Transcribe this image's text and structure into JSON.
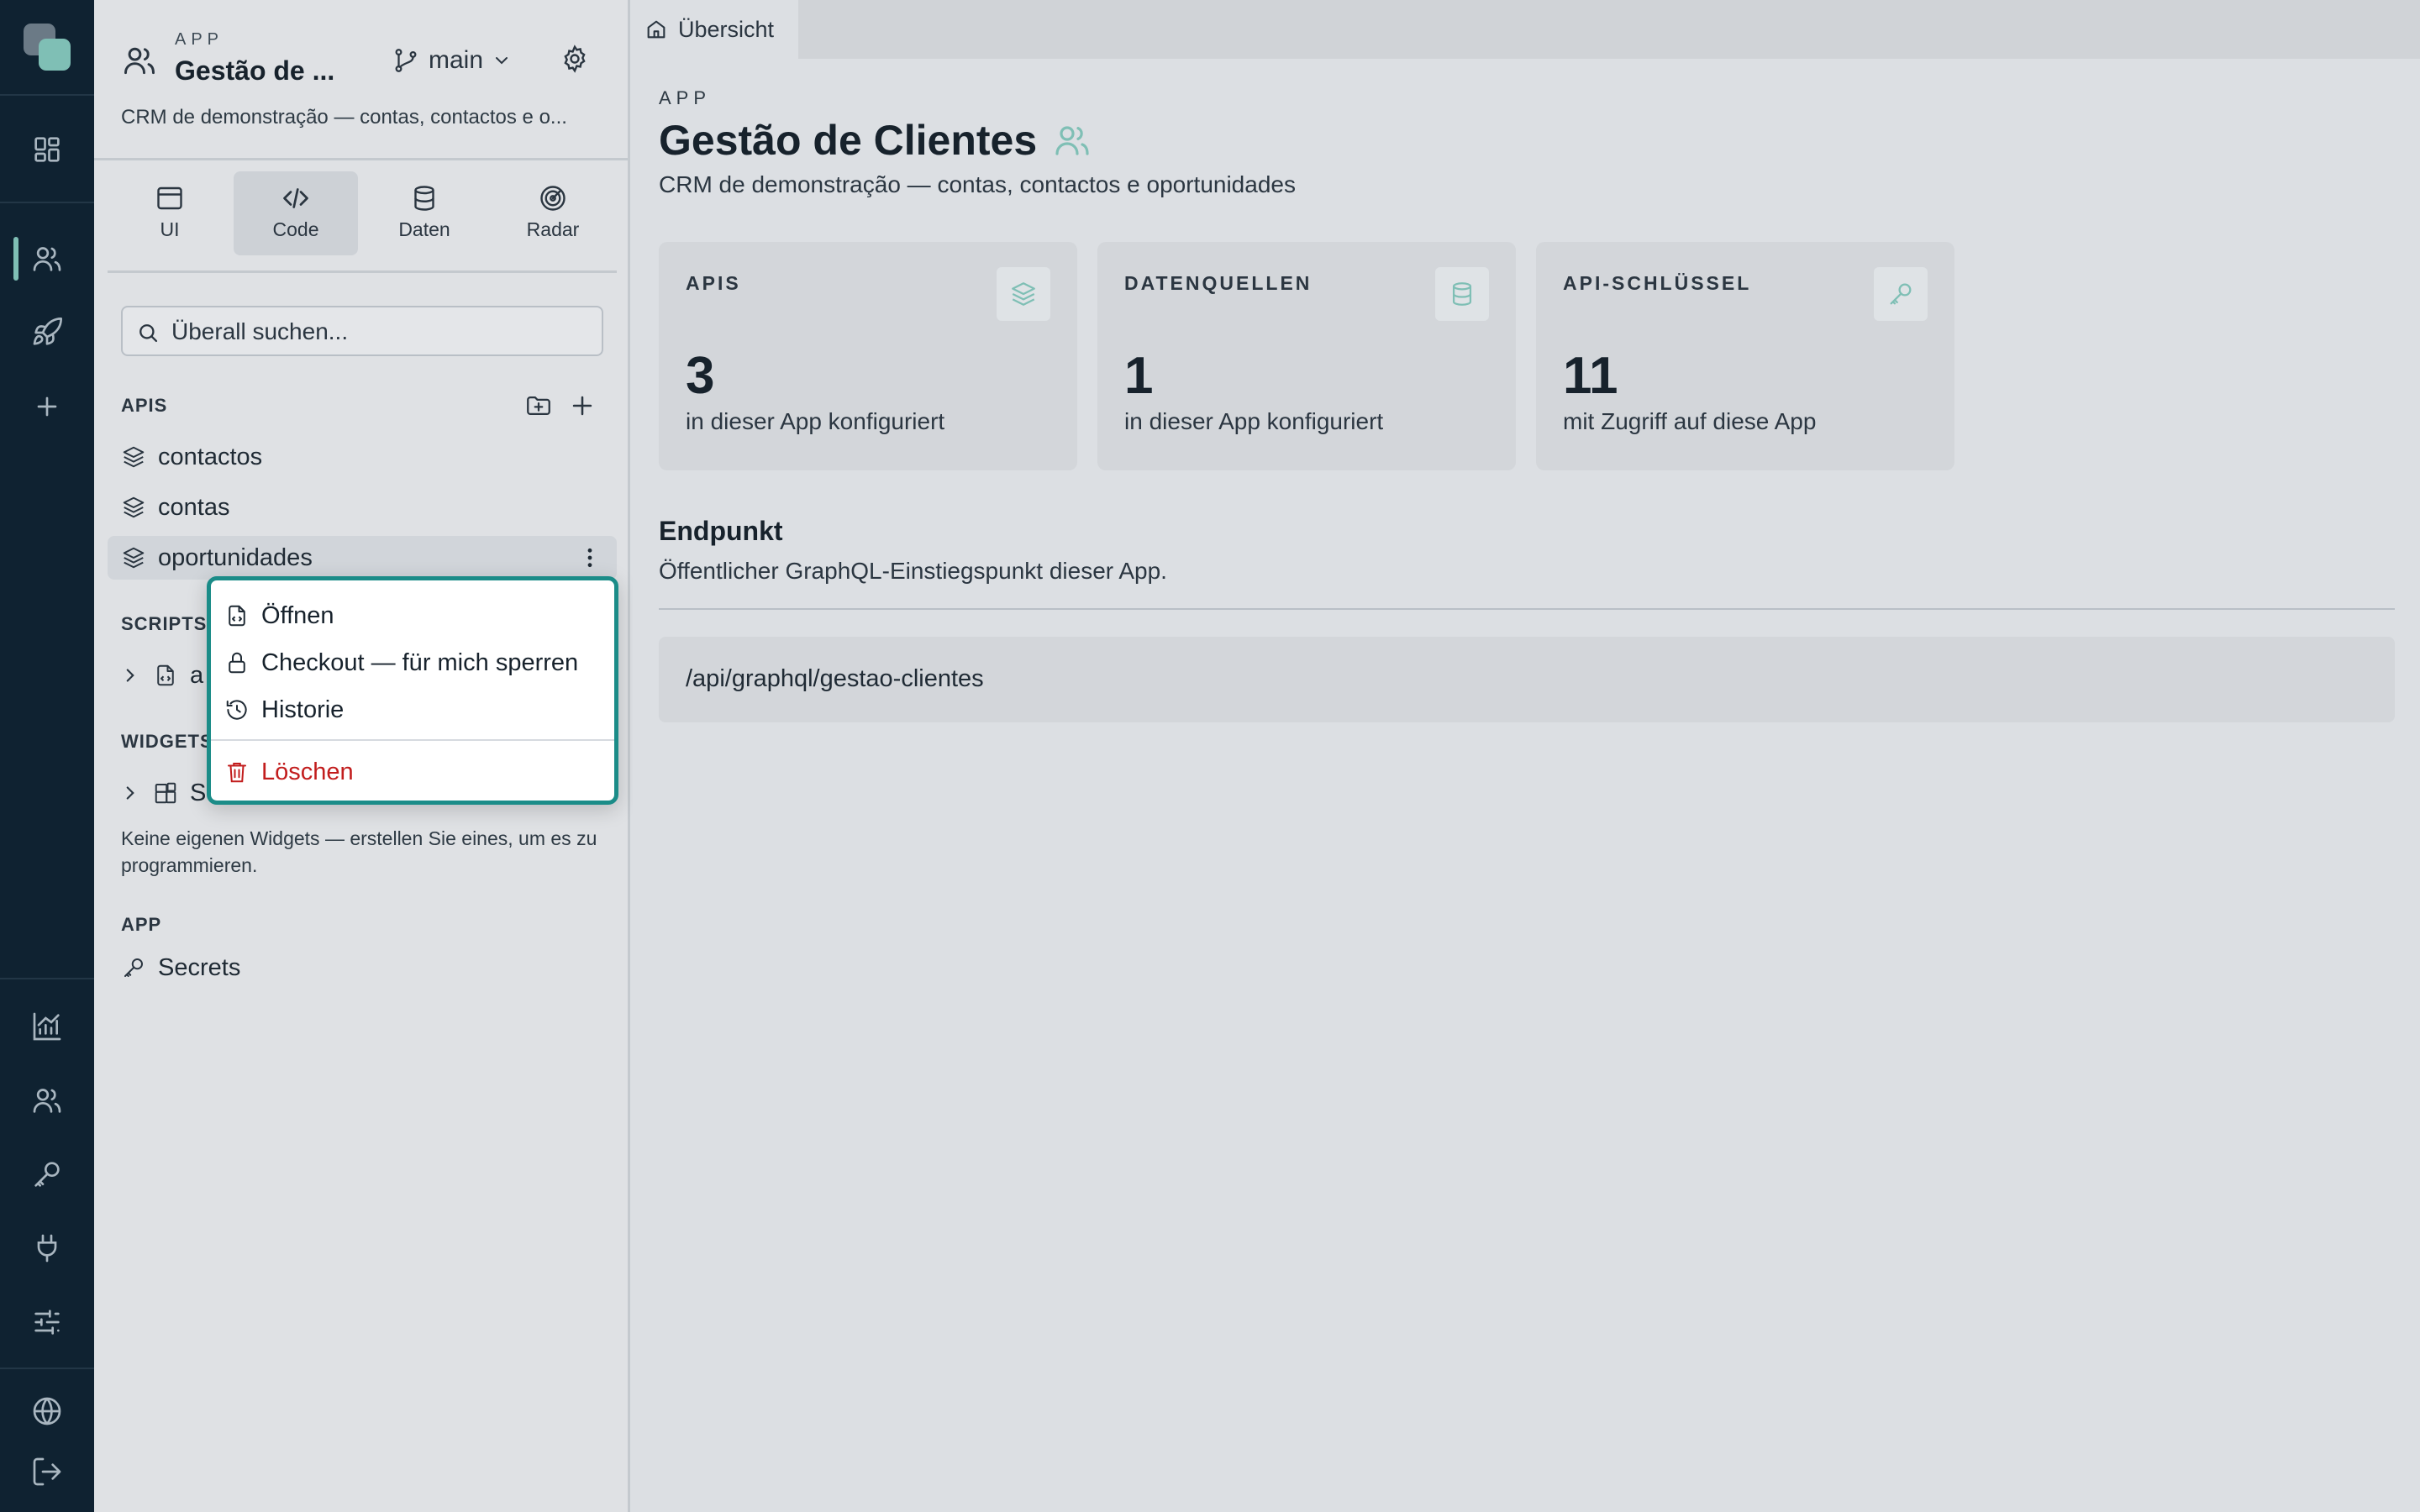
{
  "sidebar": {
    "eyebrow": "APP",
    "app_title": "Gestão de ...",
    "branch": "main",
    "description": "CRM de demonstração — contas, contactos e o...",
    "modes": [
      {
        "label": "UI",
        "icon": "browser-window-icon"
      },
      {
        "label": "Code",
        "icon": "code-icon",
        "active": true
      },
      {
        "label": "Daten",
        "icon": "database-icon"
      },
      {
        "label": "Radar",
        "icon": "radar-icon"
      }
    ],
    "search_placeholder": "Überall suchen...",
    "apis_heading": "APIS",
    "apis": [
      "contactos",
      "contas",
      "oportunidades"
    ],
    "scripts_heading": "SCRIPTS",
    "scripts_item": "a",
    "widgets_heading": "WIDGETS",
    "widgets_item": "S",
    "widgets_hint": "Keine eigenen Widgets — erstellen Sie eines, um es zu programmieren.",
    "app_heading": "APP",
    "secrets": "Secrets"
  },
  "context_menu": {
    "open": "Öffnen",
    "checkout": "Checkout — für mich sperren",
    "history": "Historie",
    "delete": "Löschen"
  },
  "main": {
    "tab": "Übersicht",
    "eyebrow": "APP",
    "title": "Gestão de Clientes",
    "subtitle": "CRM de demonstração — contas, contactos e oportunidades",
    "cards": [
      {
        "label": "APIS",
        "value": "3",
        "caption": "in dieser App konfiguriert",
        "icon": "layers-icon"
      },
      {
        "label": "DATENQUELLEN",
        "value": "1",
        "caption": "in dieser App konfiguriert",
        "icon": "database-icon"
      },
      {
        "label": "API-SCHLÜSSEL",
        "value": "11",
        "caption": "mit Zugriff auf diese App",
        "icon": "key-icon"
      }
    ],
    "endpoint_heading": "Endpunkt",
    "endpoint_desc": "Öffentlicher GraphQL-Einstiegspunkt dieser App.",
    "endpoint_path": "/api/graphql/gestao-clientes"
  },
  "colors": {
    "rail": "#0f2231",
    "accent": "#7fbfb5",
    "menu_border": "#1b8c88",
    "danger": "#c21d1d"
  }
}
